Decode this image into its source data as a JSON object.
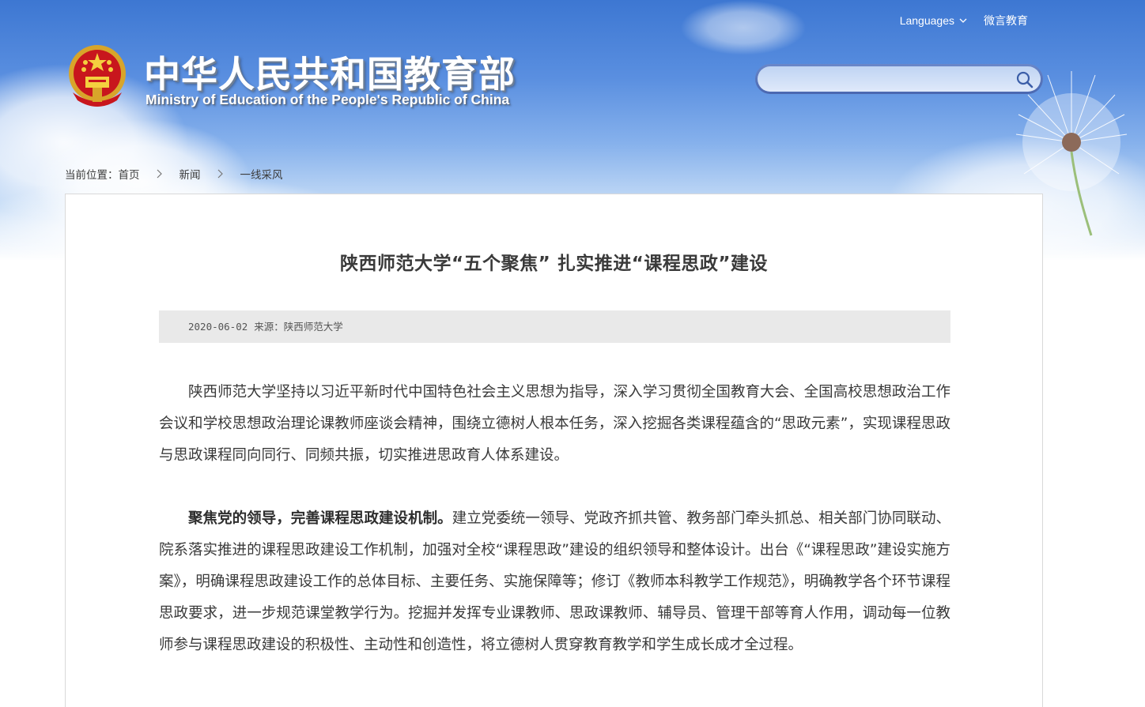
{
  "header": {
    "title_zh": "中华人民共和国教育部",
    "title_en": "Ministry of Education of the People's Republic of China",
    "languages_label": "Languages",
    "weibo_label": "微言教育",
    "search_placeholder": ""
  },
  "breadcrumb": {
    "prefix": "当前位置：",
    "items": [
      "首页",
      "新闻",
      "一线采风"
    ]
  },
  "article": {
    "title": "陕西师范大学“五个聚焦” 扎实推进“课程思政”建设",
    "date": "2020-06-02",
    "source": "来源：陕西师范大学",
    "paragraphs": [
      {
        "lead": "",
        "text": "陕西师范大学坚持以习近平新时代中国特色社会主义思想为指导，深入学习贯彻全国教育大会、全国高校思想政治工作会议和学校思想政治理论课教师座谈会精神，围绕立德树人根本任务，深入挖掘各类课程蕴含的“思政元素”，实现课程思政与思政课程同向同行、同频共振，切实推进思政育人体系建设。"
      },
      {
        "lead": "聚焦党的领导，完善课程思政建设机制。",
        "text": "建立党委统一领导、党政齐抓共管、教务部门牵头抓总、相关部门协同联动、院系落实推进的课程思政建设工作机制，加强对全校“课程思政”建设的组织领导和整体设计。出台《“课程思政”建设实施方案》，明确课程思政建设工作的总体目标、主要任务、实施保障等；修订《教师本科教学工作规范》，明确教学各个环节课程思政要求，进一步规范课堂教学行为。挖掘并发挥专业课教师、思政课教师、辅导员、管理干部等育人作用，调动每一位教师参与课程思政建设的积极性、主动性和创造性，将立德树人贯穿教育教学和学生成长成才全过程。"
      }
    ]
  },
  "colors": {
    "sky_top": "#3d77d2",
    "panel_border": "#d9d9d9",
    "meta_bg": "#e9e9e9",
    "text": "#3a3a3a"
  },
  "icons": {
    "emblem": "national-emblem-icon",
    "search": "search-icon",
    "languages_chevron": "chevron-down-icon",
    "breadcrumb_sep": "chevron-right-icon"
  }
}
